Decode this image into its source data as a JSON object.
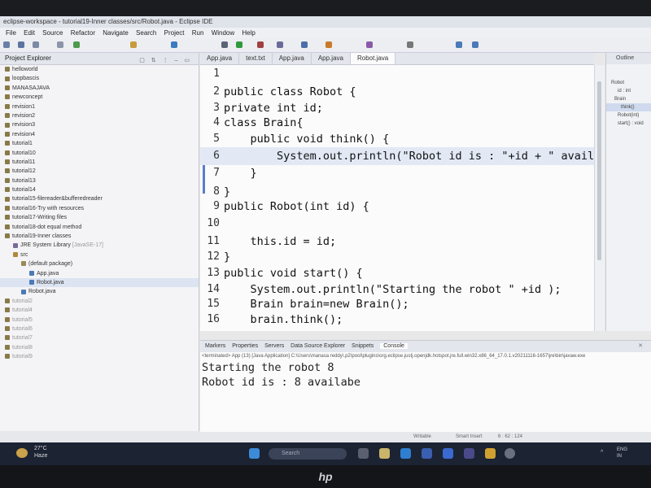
{
  "window_title": "eclipse-workspace - tutorial19-Inner classes/src/Robot.java - Eclipse IDE",
  "menu": [
    "File",
    "Edit",
    "Source",
    "Refactor",
    "Navigate",
    "Search",
    "Project",
    "Run",
    "Window",
    "Help"
  ],
  "explorer": {
    "title": "Project Explorer",
    "items": [
      "helloworld",
      "loopbascis",
      "MANASAJAVA",
      "newconcept",
      "revision1",
      "revision2",
      "revision3",
      "revision4",
      "tutorial1",
      "tutorial10",
      "tutorial11",
      "tutorial12",
      "tutorial13",
      "tutorial14",
      "tutorial15-filereader&bufferedreader",
      "tutorial16-Try with resources",
      "tutorial17-Writing files",
      "tutorial18-dot equal method",
      "tutorial19-Inner classes",
      "JRE System Library",
      "src",
      "(default package)",
      "App.java",
      "Robot.java",
      "Robot.java",
      "tutorial2",
      "tutorial4",
      "tutorial5",
      "tutorial6",
      "tutorial7",
      "tutorial8",
      "tutorial9"
    ],
    "jre_suffix": "[JavaSE-17]"
  },
  "editor_tabs": [
    "App.java",
    "text.txt",
    "App.java",
    "App.java",
    "Robot.java"
  ],
  "code_lines": [
    {
      "n": "1",
      "text": ""
    },
    {
      "n": "2",
      "text": "public class Robot {"
    },
    {
      "n": "3",
      "text": "private int id;"
    },
    {
      "n": "4",
      "text": "class Brain{"
    },
    {
      "n": "5",
      "text": "    public void think() {"
    },
    {
      "n": "6",
      "text": "        System.out.println(\"Robot id is : \"+id + \" availa"
    },
    {
      "n": "7",
      "text": "    }"
    },
    {
      "n": "8",
      "text": "}"
    },
    {
      "n": "9",
      "text": "public Robot(int id) {"
    },
    {
      "n": "10",
      "text": ""
    },
    {
      "n": "11",
      "text": "    this.id = id;"
    },
    {
      "n": "12",
      "text": "}"
    },
    {
      "n": "13",
      "text": "public void start() {"
    },
    {
      "n": "14",
      "text": "    System.out.println(\"Starting the robot \" +id );"
    },
    {
      "n": "15",
      "text": "    Brain brain=new Brain();"
    },
    {
      "n": "16",
      "text": "    brain.think();"
    }
  ],
  "outline": {
    "title": "Outline",
    "items": [
      "Robot",
      "id : int",
      "Brain",
      "think()",
      "Robot(int)",
      "start() : void"
    ]
  },
  "console": {
    "tabs": [
      "Markers",
      "Properties",
      "Servers",
      "Data Source Explorer",
      "Snippets",
      "Console"
    ],
    "info": "<terminated> App (13) [Java Application] C:\\Users\\manasa reddy\\.p2\\pool\\plugins\\org.eclipse.justj.openjdk.hotspot.jre.full.win32.x86_64_17.0.1.v20211116-1657\\jre\\bin\\javaw.exe",
    "output": [
      "Starting the robot 8",
      "Robot id is : 8 availabe"
    ]
  },
  "status": {
    "writable": "Writable",
    "insert": "Smart Insert",
    "position": "6 : 62 : 124"
  },
  "taskbar": {
    "temp": "27°C",
    "weather": "Haze",
    "search": "Search",
    "lang": "ENG",
    "region": "IN"
  },
  "brand": "hp"
}
